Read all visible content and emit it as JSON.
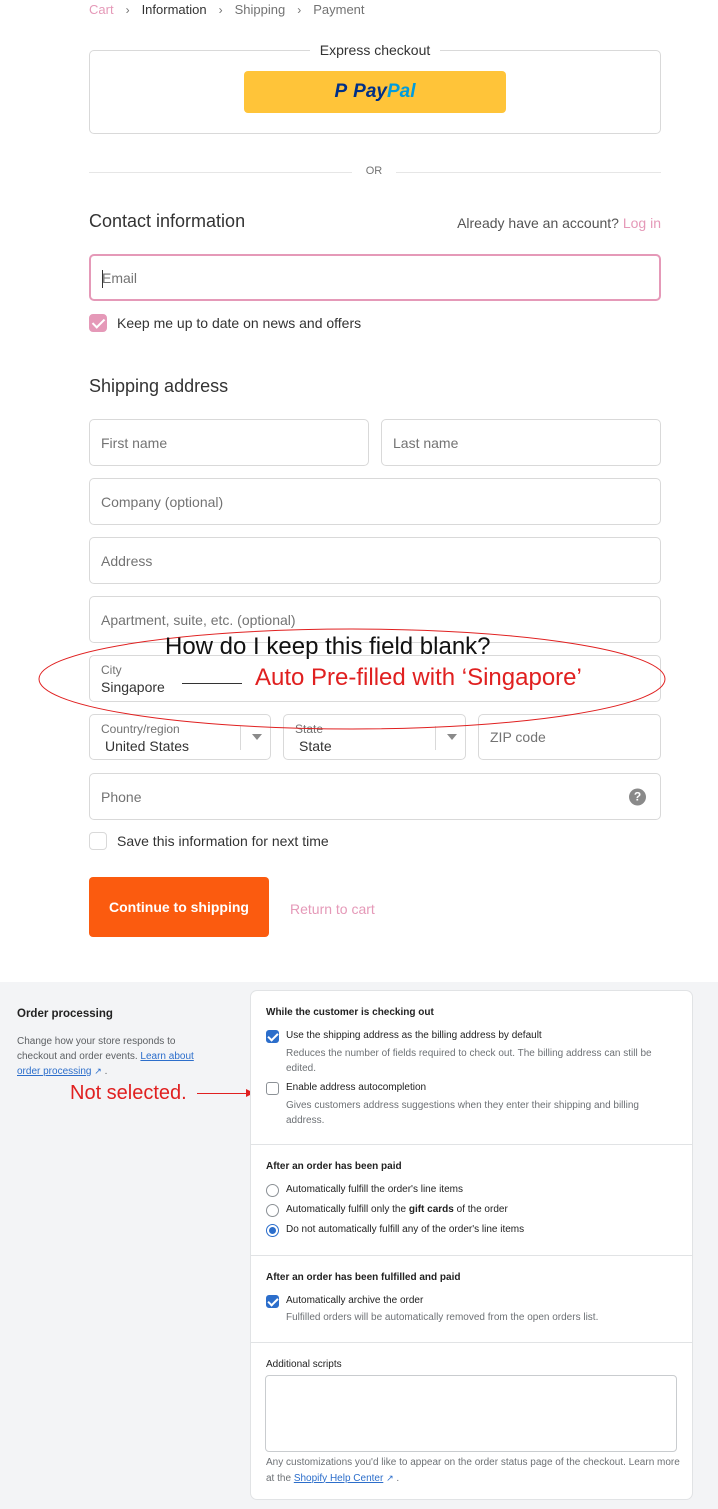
{
  "breadcrumb": {
    "items": [
      "Cart",
      "Information",
      "Shipping",
      "Payment"
    ]
  },
  "express": {
    "title": "Express checkout",
    "paypal_mark": "P",
    "paypal_word_a": "Pay",
    "paypal_word_b": "Pal"
  },
  "or_label": "OR",
  "contact": {
    "heading": "Contact information",
    "account_prompt": "Already have an account?",
    "login_label": "Log in",
    "email_placeholder": "Email",
    "newsletter_label": "Keep me up to date on news and offers",
    "newsletter_checked": true
  },
  "shipping": {
    "heading": "Shipping address",
    "first_name_placeholder": "First name",
    "last_name_placeholder": "Last name",
    "company_placeholder": "Company (optional)",
    "address_placeholder": "Address",
    "apartment_placeholder": "Apartment, suite, etc. (optional)",
    "city_label": "City",
    "city_value": "Singapore",
    "country_label": "Country/region",
    "country_value": "United States",
    "state_label": "State",
    "state_value": "State",
    "zip_placeholder": "ZIP code",
    "phone_placeholder": "Phone",
    "help_glyph": "?",
    "save_label": "Save this information for next time",
    "save_checked": false
  },
  "actions": {
    "continue_label": "Continue to shipping",
    "return_label": "Return to cart"
  },
  "annotations": {
    "question": "How do I keep this field blank?",
    "prefilled": "Auto Pre-filled with ‘Singapore’",
    "not_selected": "Not selected."
  },
  "admin": {
    "title": "Order processing",
    "desc_text": "Change how your store responds to checkout and order events.",
    "desc_link": "Learn about order processing",
    "checking_out": {
      "heading": "While the customer is checking out",
      "billing_label": "Use the shipping address as the billing address by default",
      "billing_sub": "Reduces the number of fields required to check out. The billing address can still be edited.",
      "billing_checked": true,
      "autocomplete_label": "Enable address autocompletion",
      "autocomplete_sub": "Gives customers address suggestions when they enter their shipping and billing address.",
      "autocomplete_checked": false
    },
    "paid": {
      "heading": "After an order has been paid",
      "opt1": "Automatically fulfill the order's line items",
      "opt2_pre": "Automatically fulfill only the ",
      "opt2_bold": "gift cards",
      "opt2_post": " of the order",
      "opt3": "Do not automatically fulfill any of the order's line items",
      "selected": 3
    },
    "fulfilled": {
      "heading": "After an order has been fulfilled and paid",
      "archive_label": "Automatically archive the order",
      "archive_sub": "Fulfilled orders will be automatically removed from the open orders list.",
      "archive_checked": true
    },
    "scripts": {
      "label": "Additional scripts",
      "help_text": "Any customizations you'd like to appear on the order status page of the checkout. Learn more at the",
      "help_link": "Shopify Help Center",
      "help_end": "."
    }
  },
  "colors": {
    "accent_pink": "#e599b8",
    "primary_button": "#fb5b0f",
    "paypal_yellow": "#ffc439",
    "admin_blue": "#2c6ecb",
    "annotation_red": "#e02020"
  }
}
